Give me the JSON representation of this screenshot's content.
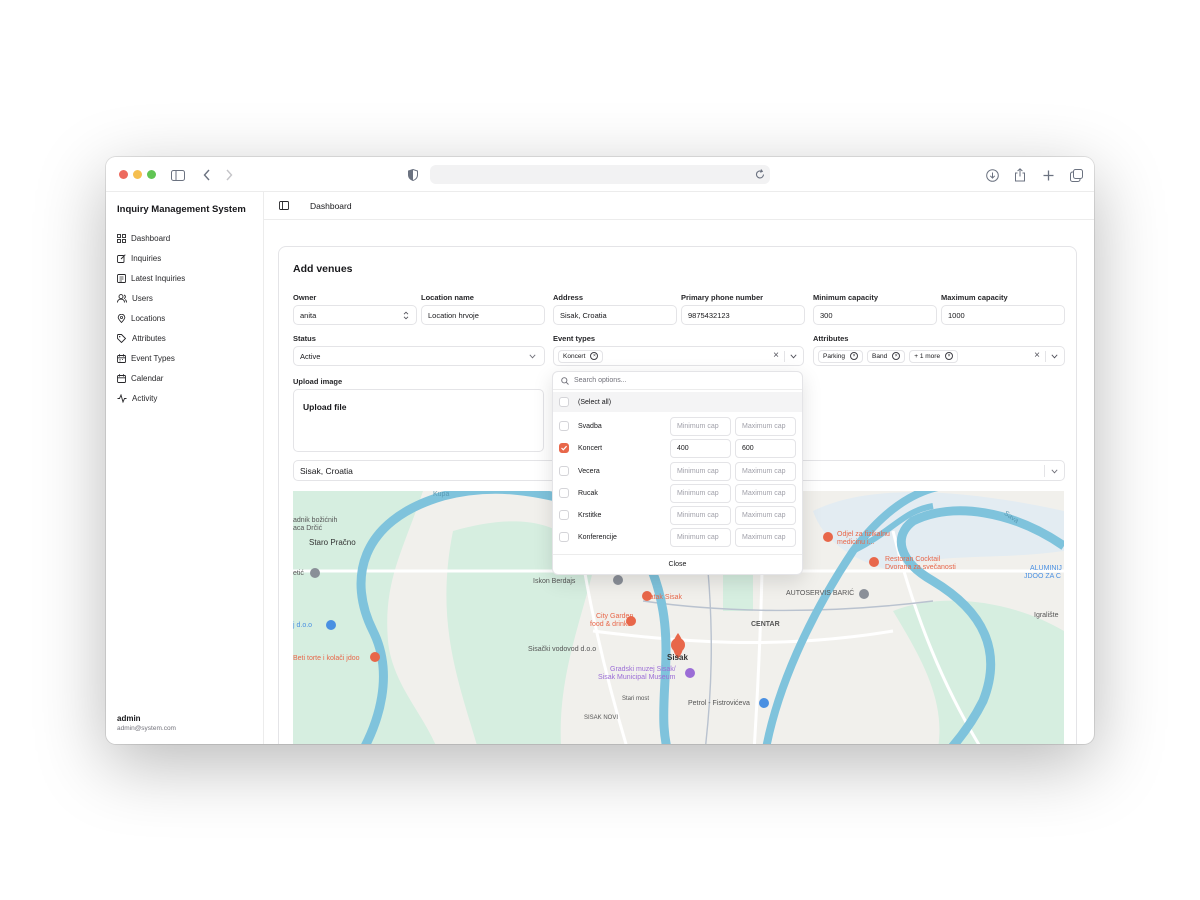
{
  "window": {
    "controls": [
      "close",
      "minimize",
      "zoom"
    ]
  },
  "app": {
    "title": "Inquiry Management System"
  },
  "sidebar": {
    "items": [
      {
        "label": "Dashboard",
        "icon": "dashboard-icon"
      },
      {
        "label": "Inquiries",
        "icon": "edit-icon"
      },
      {
        "label": "Latest Inquiries",
        "icon": "document-icon"
      },
      {
        "label": "Users",
        "icon": "users-icon"
      },
      {
        "label": "Locations",
        "icon": "map-pin-icon"
      },
      {
        "label": "Attributes",
        "icon": "tag-icon"
      },
      {
        "label": "Event Types",
        "icon": "calendar-days-icon"
      },
      {
        "label": "Calendar",
        "icon": "calendar-icon"
      },
      {
        "label": "Activity",
        "icon": "activity-icon"
      }
    ],
    "user": {
      "name": "admin",
      "email": "admin@system.com"
    }
  },
  "header": {
    "breadcrumb": "Dashboard"
  },
  "form": {
    "title": "Add venues",
    "owner": {
      "label": "Owner",
      "value": "anita"
    },
    "location_name": {
      "label": "Location name",
      "value": "Location hrvoje"
    },
    "address": {
      "label": "Address",
      "value": "Sisak, Croatia"
    },
    "phone": {
      "label": "Primary phone number",
      "value": "9875432123"
    },
    "min_capacity": {
      "label": "Minimum capacity",
      "value": "300"
    },
    "max_capacity": {
      "label": "Maximum capacity",
      "value": "1000"
    },
    "status": {
      "label": "Status",
      "value": "Active"
    },
    "event_types": {
      "label": "Event types",
      "chips": [
        "Koncert"
      ]
    },
    "attributes": {
      "label": "Attributes",
      "chips": [
        "Parking",
        "Band"
      ],
      "more": "+ 1 more"
    },
    "upload": {
      "label": "Upload image",
      "button": "Upload file"
    },
    "map_search": {
      "value": "Sisak, Croatia"
    }
  },
  "dropdown": {
    "search_placeholder": "Search options...",
    "select_all": "(Select all)",
    "options": [
      {
        "label": "Svadba",
        "checked": false,
        "min": "",
        "max": ""
      },
      {
        "label": "Koncert",
        "checked": true,
        "min": "400",
        "max": "600"
      },
      {
        "label": "Vecera",
        "checked": false,
        "min": "",
        "max": ""
      },
      {
        "label": "Rucak",
        "checked": false,
        "min": "",
        "max": ""
      },
      {
        "label": "Krstitke",
        "checked": false,
        "min": "",
        "max": ""
      },
      {
        "label": "Konferencije",
        "checked": false,
        "min": "",
        "max": ""
      }
    ],
    "min_placeholder": "Minimum cap",
    "max_placeholder": "Maximum cap",
    "close": "Close"
  },
  "map": {
    "labels": {
      "staro_pracno": "Staro Pračno",
      "centar": "CENTAR",
      "sisak": "Sisak",
      "batak": "Batak Sisak",
      "city_garden": "City Garden",
      "city_garden2": "food & drinks",
      "vodovod": "Sisački vodovod d.o.o",
      "muzej": "Gradski muzej Sisak/",
      "muzej2": "Sisak Municipal Museum",
      "petrol": "Petrol - Fistrovićeva",
      "autoservis": "AUTOSERVIS BARIĆ",
      "odjel": "Odjel za fizikalnu",
      "odjel2": "medicinu i...",
      "restoran": "Restoran Cocktail",
      "restoran2": "Dvorana za svečanosti",
      "beti": "Beti torte i kolači jdoo",
      "iskon": "Iskon Berdajs",
      "aluminij": "ALUMINIJ",
      "aluminij2": "JDOO ZA C",
      "igraliste": "Igralište",
      "kupa": "Kupa",
      "sava": "Sava",
      "sisak_novi": "SISAK NOVI",
      "stari_most": "Stari most",
      "nadnik": "adnik božićnih",
      "nadnik2": "aca Drčić",
      "etic": "etić",
      "jdoo": "j d.o.o"
    },
    "colors": {
      "water": "#7fc3dc",
      "park": "#d4ede0",
      "poi": "#e8674a",
      "pin": "#e8674a"
    }
  },
  "colors": {
    "accent": "#e8674a",
    "border": "#e4e4e7"
  }
}
